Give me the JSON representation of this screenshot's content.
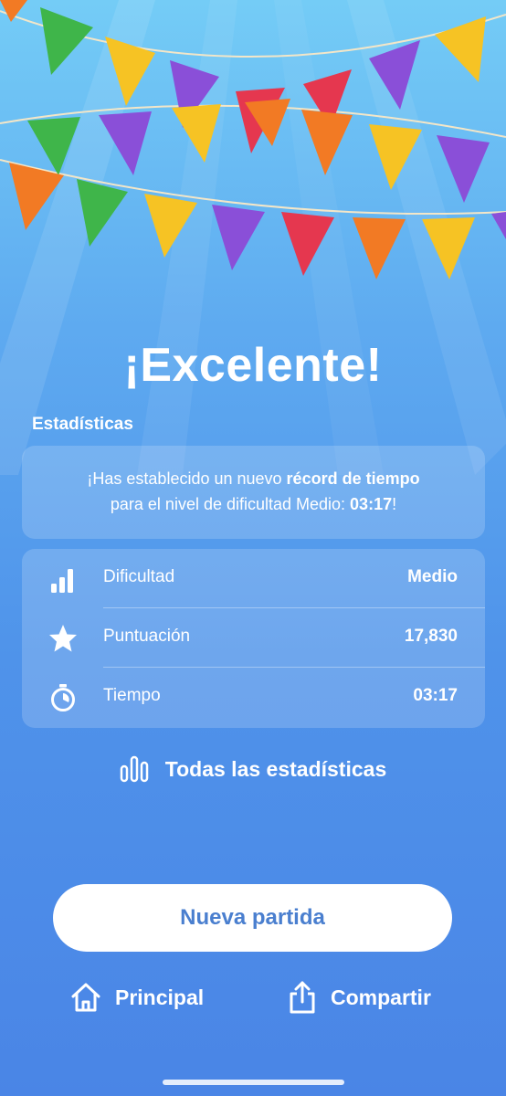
{
  "header": {
    "title": "¡Excelente!"
  },
  "stats_section": {
    "label": "Estadísticas"
  },
  "record_message": {
    "line1_prefix": "¡Has establecido un nuevo ",
    "line1_bold": "récord de tiempo",
    "line2_prefix": "para el nivel de dificultad Medio: ",
    "line2_bold": "03:17",
    "line2_suffix": "!"
  },
  "stats": [
    {
      "icon": "signal-bars-icon",
      "label": "Dificultad",
      "value": "Medio"
    },
    {
      "icon": "star-icon",
      "label": "Puntuación",
      "value": "17,830"
    },
    {
      "icon": "stopwatch-icon",
      "label": "Tiempo",
      "value": "03:17"
    }
  ],
  "all_stats_link": {
    "icon": "bar-chart-icon",
    "label": "Todas las estadísticas"
  },
  "primary_button": {
    "label": "Nueva partida"
  },
  "bottom_actions": {
    "home": {
      "icon": "home-icon",
      "label": "Principal"
    },
    "share": {
      "icon": "share-icon",
      "label": "Compartir"
    }
  },
  "colors": {
    "bg_top": "#74ccf6",
    "bg_bottom": "#4a85e6",
    "button_text": "#4a7fcf",
    "flag_green": "#3fb54a",
    "flag_yellow": "#f6c324",
    "flag_purple": "#8a4fd8",
    "flag_red": "#e5374f",
    "flag_orange": "#f27a24"
  }
}
